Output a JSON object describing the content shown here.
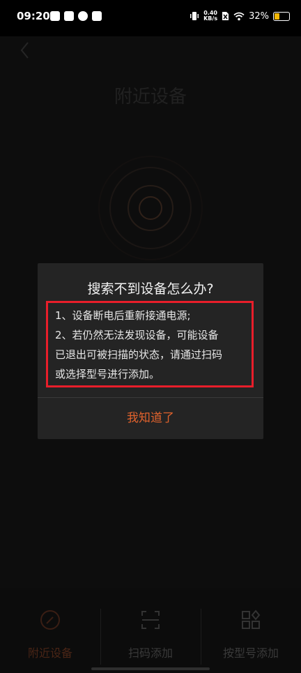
{
  "status_bar": {
    "time": "09:20",
    "net_speed_value": "0.40",
    "net_speed_unit": "KB/s",
    "battery_percent": "32%",
    "battery_level": 0.32,
    "battery_color": "#f2b705"
  },
  "header": {
    "back_icon": "chevron-left-icon",
    "title": "附近设备"
  },
  "dialog": {
    "title": "搜索不到设备怎么办?",
    "lines": [
      "1、设备断电后重新接通电源;",
      "2、若仍然无法发现设备，可能设备",
      "已退出可被扫描的状态，请通过扫码",
      "或选择型号进行添加。"
    ],
    "confirm_label": "我知道了",
    "highlight_color": "#e81e2a",
    "accent_color": "#e0622d"
  },
  "tabs": [
    {
      "label": "附近设备",
      "icon": "compass-icon",
      "active": true
    },
    {
      "label": "扫码添加",
      "icon": "scan-icon",
      "active": false
    },
    {
      "label": "按型号添加",
      "icon": "grid-icon",
      "active": false
    }
  ]
}
